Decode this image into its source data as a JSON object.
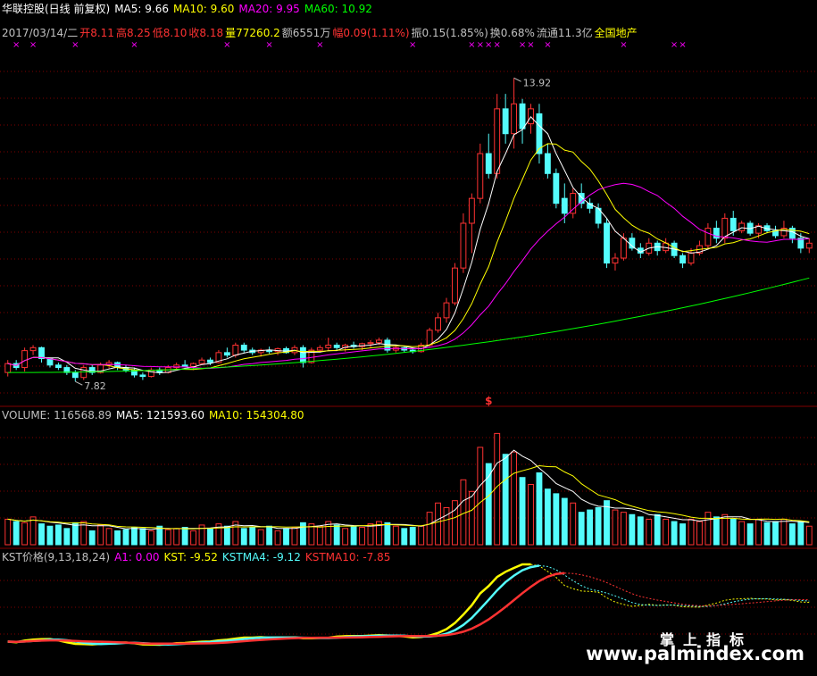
{
  "header": {
    "stock_name": "华联控股(日线 前复权)",
    "ma5": "MA5: 9.66",
    "ma10": "MA10: 9.60",
    "ma20": "MA20: 9.95",
    "ma60": "MA60: 10.92"
  },
  "quote": {
    "date": "2017/03/14/二",
    "open": "开8.11",
    "high": "高8.25",
    "low": "低8.10",
    "close": "收8.18",
    "volume": "量77260.2",
    "amount": "额6551万",
    "change": "幅0.09(1.11%)",
    "amplitude": "振0.15(1.85%)",
    "turnover": "换0.68%",
    "float": "流通11.3亿",
    "sector": "全国地产"
  },
  "volume_header": {
    "volume": "VOLUME: 116568.89",
    "ma5": "MA5: 121593.60",
    "ma10": "MA10: 154304.80"
  },
  "kst_header": {
    "name": "KST价格(9,13,18,24)",
    "a1": "A1: 0.00",
    "kst": "KST: -9.52",
    "kstma4": "KSTMA4: -9.12",
    "kstma10": "KSTMA10: -7.85"
  },
  "watermark": {
    "cn": "掌上指标",
    "url": "www.palmindex.com"
  },
  "colors": {
    "up": "#ff3232",
    "down": "#54fcfc",
    "ma5": "#ffffff",
    "ma10": "#ffff00",
    "ma20": "#ff00ff",
    "ma60": "#00ff00",
    "grid": "#800000",
    "marker": "#ff00ff"
  },
  "chart_data": {
    "type": "candlestick",
    "price_axis_range": [
      7.5,
      14.5
    ],
    "annotations": {
      "max_label": "13.92",
      "min_label": "7.82",
      "marker_symbol": "$",
      "x_marker": "×"
    },
    "candles": [
      [
        8.0,
        8.25,
        7.92,
        8.18
      ],
      [
        8.18,
        8.25,
        8.05,
        8.1
      ],
      [
        8.1,
        8.5,
        8.02,
        8.44
      ],
      [
        8.44,
        8.55,
        8.35,
        8.5
      ],
      [
        8.5,
        8.52,
        8.2,
        8.28
      ],
      [
        8.28,
        8.3,
        8.1,
        8.15
      ],
      [
        8.15,
        8.2,
        8.05,
        8.1
      ],
      [
        8.1,
        8.15,
        7.95,
        8.0
      ],
      [
        8.0,
        8.05,
        7.82,
        7.9
      ],
      [
        7.9,
        8.15,
        7.85,
        8.1
      ],
      [
        8.1,
        8.15,
        7.95,
        8.0
      ],
      [
        8.0,
        8.2,
        7.98,
        8.15
      ],
      [
        8.15,
        8.25,
        8.08,
        8.2
      ],
      [
        8.2,
        8.22,
        8.05,
        8.1
      ],
      [
        8.1,
        8.15,
        8.0,
        8.05
      ],
      [
        8.05,
        8.1,
        7.9,
        7.95
      ],
      [
        7.95,
        8.0,
        7.85,
        7.92
      ],
      [
        7.92,
        8.1,
        7.9,
        8.05
      ],
      [
        8.05,
        8.1,
        7.95,
        8.0
      ],
      [
        8.0,
        8.15,
        7.98,
        8.1
      ],
      [
        8.1,
        8.2,
        8.05,
        8.15
      ],
      [
        8.15,
        8.25,
        8.1,
        8.12
      ],
      [
        8.12,
        8.2,
        8.05,
        8.18
      ],
      [
        8.18,
        8.3,
        8.15,
        8.25
      ],
      [
        8.25,
        8.3,
        8.15,
        8.2
      ],
      [
        8.2,
        8.45,
        8.18,
        8.4
      ],
      [
        8.4,
        8.5,
        8.3,
        8.35
      ],
      [
        8.35,
        8.6,
        8.3,
        8.55
      ],
      [
        8.55,
        8.6,
        8.4,
        8.45
      ],
      [
        8.45,
        8.5,
        8.35,
        8.4
      ],
      [
        8.4,
        8.48,
        8.32,
        8.45
      ],
      [
        8.45,
        8.52,
        8.38,
        8.42
      ],
      [
        8.42,
        8.5,
        8.35,
        8.48
      ],
      [
        8.48,
        8.52,
        8.38,
        8.4
      ],
      [
        8.4,
        8.55,
        8.35,
        8.5
      ],
      [
        8.5,
        8.55,
        8.1,
        8.2
      ],
      [
        8.2,
        8.5,
        8.18,
        8.45
      ],
      [
        8.45,
        8.55,
        8.4,
        8.5
      ],
      [
        8.5,
        8.7,
        8.45,
        8.55
      ],
      [
        8.55,
        8.6,
        8.45,
        8.5
      ],
      [
        8.5,
        8.58,
        8.42,
        8.55
      ],
      [
        8.55,
        8.62,
        8.48,
        8.52
      ],
      [
        8.52,
        8.6,
        8.45,
        8.58
      ],
      [
        8.58,
        8.65,
        8.5,
        8.6
      ],
      [
        8.6,
        8.7,
        8.55,
        8.65
      ],
      [
        8.65,
        8.7,
        8.4,
        8.45
      ],
      [
        8.45,
        8.55,
        8.4,
        8.5
      ],
      [
        8.5,
        8.52,
        8.4,
        8.45
      ],
      [
        8.45,
        8.5,
        8.38,
        8.42
      ],
      [
        8.42,
        8.6,
        8.4,
        8.55
      ],
      [
        8.55,
        8.9,
        8.5,
        8.85
      ],
      [
        8.85,
        9.2,
        8.8,
        9.1
      ],
      [
        9.1,
        9.5,
        9.0,
        9.4
      ],
      [
        9.4,
        10.2,
        9.35,
        10.1
      ],
      [
        10.1,
        11.2,
        10.0,
        11.0
      ],
      [
        11.0,
        11.6,
        10.4,
        11.5
      ],
      [
        11.5,
        12.6,
        11.4,
        12.4
      ],
      [
        12.4,
        12.8,
        11.9,
        12.0
      ],
      [
        12.0,
        13.6,
        11.9,
        13.3
      ],
      [
        13.3,
        13.6,
        12.6,
        12.8
      ],
      [
        12.8,
        13.92,
        12.5,
        13.4
      ],
      [
        13.4,
        13.5,
        12.6,
        12.9
      ],
      [
        13.0,
        13.4,
        12.8,
        13.3
      ],
      [
        13.2,
        13.4,
        12.2,
        12.4
      ],
      [
        12.4,
        12.6,
        11.9,
        12.0
      ],
      [
        12.0,
        12.1,
        11.3,
        11.4
      ],
      [
        11.5,
        11.8,
        11.0,
        11.2
      ],
      [
        11.2,
        11.7,
        11.1,
        11.6
      ],
      [
        11.6,
        11.8,
        11.3,
        11.4
      ],
      [
        11.4,
        11.5,
        11.2,
        11.3
      ],
      [
        11.3,
        11.4,
        10.9,
        11.0
      ],
      [
        11.0,
        11.1,
        10.1,
        10.2
      ],
      [
        10.2,
        10.4,
        10.05,
        10.3
      ],
      [
        10.3,
        10.8,
        10.25,
        10.7
      ],
      [
        10.7,
        10.8,
        10.45,
        10.5
      ],
      [
        10.5,
        10.6,
        10.3,
        10.4
      ],
      [
        10.4,
        10.7,
        10.35,
        10.6
      ],
      [
        10.6,
        10.65,
        10.35,
        10.45
      ],
      [
        10.45,
        10.7,
        10.4,
        10.6
      ],
      [
        10.6,
        10.65,
        10.3,
        10.35
      ],
      [
        10.35,
        10.4,
        10.1,
        10.2
      ],
      [
        10.2,
        10.5,
        10.15,
        10.4
      ],
      [
        10.4,
        10.65,
        10.35,
        10.55
      ],
      [
        10.55,
        11.0,
        10.5,
        10.9
      ],
      [
        10.9,
        11.05,
        10.6,
        10.7
      ],
      [
        10.7,
        11.2,
        10.6,
        11.1
      ],
      [
        11.1,
        11.25,
        10.75,
        10.85
      ],
      [
        10.85,
        11.05,
        10.8,
        11.0
      ],
      [
        11.0,
        11.05,
        10.75,
        10.8
      ],
      [
        10.8,
        11.0,
        10.7,
        10.95
      ],
      [
        10.95,
        11.0,
        10.8,
        10.85
      ],
      [
        10.85,
        10.95,
        10.7,
        10.75
      ],
      [
        10.75,
        11.05,
        10.7,
        10.9
      ],
      [
        10.9,
        10.95,
        10.6,
        10.7
      ],
      [
        10.7,
        10.8,
        10.4,
        10.5
      ],
      [
        10.5,
        10.7,
        10.4,
        10.6
      ]
    ],
    "ma60_range": [
      8.0,
      9.9
    ],
    "volume_axis_range": [
      0,
      520000
    ],
    "volume": [
      110000,
      100000,
      95000,
      120000,
      90000,
      80000,
      85000,
      70000,
      95000,
      100000,
      60000,
      85000,
      70000,
      60000,
      65000,
      75000,
      70000,
      60000,
      80000,
      65000,
      70000,
      75000,
      60000,
      85000,
      70000,
      90000,
      80000,
      100000,
      70000,
      75000,
      65000,
      80000,
      60000,
      70000,
      75000,
      95000,
      90000,
      80000,
      100000,
      85000,
      70000,
      80000,
      75000,
      90000,
      100000,
      95000,
      80000,
      70000,
      75000,
      80000,
      140000,
      180000,
      160000,
      190000,
      280000,
      230000,
      420000,
      350000,
      480000,
      390000,
      400000,
      290000,
      260000,
      310000,
      240000,
      220000,
      200000,
      180000,
      140000,
      150000,
      160000,
      190000,
      150000,
      140000,
      130000,
      120000,
      110000,
      130000,
      110000,
      100000,
      90000,
      110000,
      100000,
      140000,
      120000,
      130000,
      110000,
      100000,
      90000,
      110000,
      95000,
      100000,
      110000,
      90000,
      100000,
      80000
    ]
  }
}
